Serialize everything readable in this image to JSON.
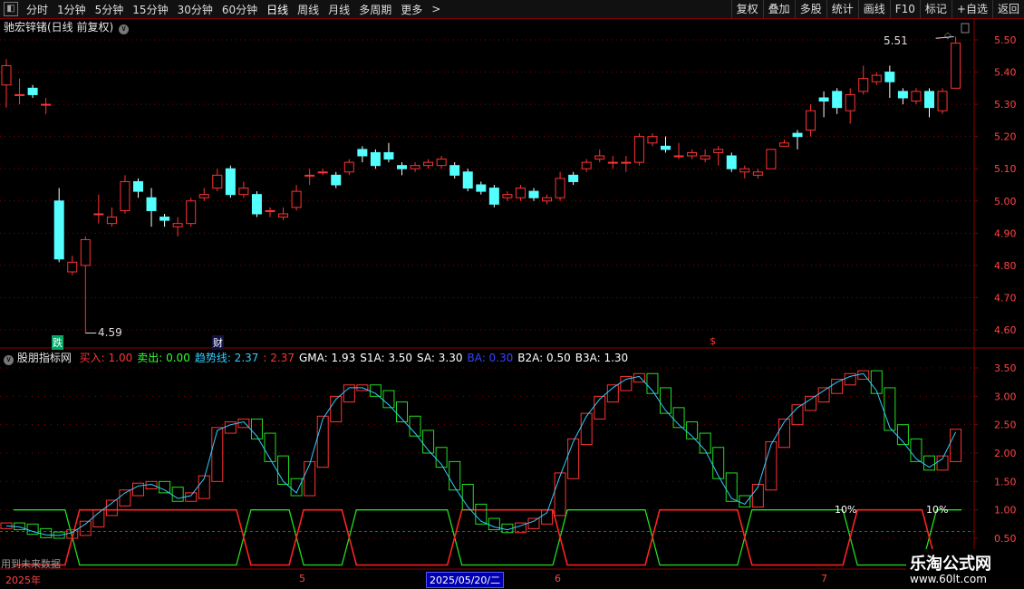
{
  "toolbar": {
    "periods": [
      "分时",
      "1分钟",
      "5分钟",
      "15分钟",
      "30分钟",
      "60分钟",
      "日线",
      "周线",
      "月线",
      "多周期",
      "更多"
    ],
    "active_period": "日线",
    "more_arrow": ">",
    "actions": [
      "复权",
      "叠加",
      "多股",
      "统计",
      "画线",
      "F10",
      "标记",
      "+自选",
      "返回"
    ]
  },
  "main_panel": {
    "title": "驰宏锌锗(日线 前复权)",
    "high_label": "5.51",
    "low_label": "4.59",
    "markers": [
      "跌",
      "财",
      "$"
    ]
  },
  "indicator_panel": {
    "name": "股朋指标网",
    "params": [
      {
        "label": "买入:",
        "value": "1.00",
        "color": "#ff3333"
      },
      {
        "label": "卖出:",
        "value": "0.00",
        "color": "#33ff33"
      },
      {
        "label": "趋势线:",
        "value": "2.37",
        "color": "#33ccff"
      },
      {
        "label": ":",
        "value": "2.37",
        "color": "#ff3333"
      },
      {
        "label": "GMA:",
        "value": "1.93",
        "color": "#ffffff"
      },
      {
        "label": "S1A:",
        "value": "3.50",
        "color": "#ffffff"
      },
      {
        "label": "SA:",
        "value": "3.30",
        "color": "#ffffff"
      },
      {
        "label": "BA:",
        "value": "0.30",
        "color": "#3344ff"
      },
      {
        "label": "B2A:",
        "value": "0.50",
        "color": "#ffffff"
      },
      {
        "label": "B3A:",
        "value": "1.30",
        "color": "#ffffff"
      }
    ],
    "pct_labels": [
      "10%",
      "10%"
    ],
    "future_note": "用到未来数据"
  },
  "date_axis": {
    "labels": [
      "2025年",
      "5",
      "6",
      "7"
    ],
    "cursor_date": "2025/05/20/二"
  },
  "watermark": {
    "line1": "乐淘公式网",
    "line2": "www.60lt.com"
  },
  "colors": {
    "up": "#ff3333",
    "down": "#54ffff",
    "grid": "#8b0000",
    "buy": "#ff2222",
    "sell": "#22dd22",
    "trend": "#33ccff"
  },
  "chart_data": {
    "type": "candlestick",
    "price_axis": {
      "ticks": [
        5.5,
        5.4,
        5.3,
        5.2,
        5.1,
        5.0,
        4.9,
        4.8,
        4.7,
        4.6
      ],
      "ylim": [
        4.55,
        5.56
      ]
    },
    "indicator_axis": {
      "ticks": [
        3.5,
        3.0,
        2.5,
        2.0,
        1.5,
        1.0,
        0.5
      ],
      "ylim": [
        0.45,
        3.62
      ]
    },
    "candles": [
      [
        5.36,
        5.42,
        5.44,
        5.29
      ],
      [
        5.33,
        5.33,
        5.38,
        5.3
      ],
      [
        5.35,
        5.33,
        5.36,
        5.32
      ],
      [
        5.3,
        5.3,
        5.32,
        5.27
      ],
      [
        5.0,
        4.82,
        5.04,
        4.81
      ],
      [
        4.78,
        4.81,
        4.83,
        4.77
      ],
      [
        4.8,
        4.88,
        4.89,
        4.59
      ],
      [
        4.96,
        4.96,
        5.02,
        4.93
      ],
      [
        4.93,
        4.95,
        4.98,
        4.92
      ],
      [
        4.97,
        5.06,
        5.08,
        4.96
      ],
      [
        5.06,
        5.03,
        5.07,
        5.01
      ],
      [
        5.01,
        4.97,
        5.04,
        4.92
      ],
      [
        4.95,
        4.94,
        4.96,
        4.92
      ],
      [
        4.92,
        4.93,
        4.95,
        4.89
      ],
      [
        4.93,
        5.0,
        5.01,
        4.92
      ],
      [
        5.01,
        5.02,
        5.04,
        5.0
      ],
      [
        5.04,
        5.08,
        5.1,
        5.03
      ],
      [
        5.1,
        5.02,
        5.11,
        5.01
      ],
      [
        5.02,
        5.04,
        5.06,
        5.01
      ],
      [
        5.02,
        4.96,
        5.03,
        4.95
      ],
      [
        4.97,
        4.97,
        4.98,
        4.95
      ],
      [
        4.95,
        4.96,
        4.98,
        4.94
      ],
      [
        4.98,
        5.03,
        5.05,
        4.97
      ],
      [
        5.08,
        5.08,
        5.1,
        5.05
      ],
      [
        5.09,
        5.09,
        5.1,
        5.08
      ],
      [
        5.08,
        5.05,
        5.09,
        5.04
      ],
      [
        5.09,
        5.12,
        5.13,
        5.08
      ],
      [
        5.16,
        5.14,
        5.17,
        5.12
      ],
      [
        5.15,
        5.11,
        5.16,
        5.1
      ],
      [
        5.15,
        5.13,
        5.18,
        5.12
      ],
      [
        5.11,
        5.1,
        5.12,
        5.08
      ],
      [
        5.1,
        5.11,
        5.12,
        5.09
      ],
      [
        5.11,
        5.12,
        5.13,
        5.1
      ],
      [
        5.11,
        5.13,
        5.14,
        5.1
      ],
      [
        5.11,
        5.08,
        5.12,
        5.07
      ],
      [
        5.09,
        5.04,
        5.1,
        5.03
      ],
      [
        5.05,
        5.03,
        5.06,
        5.02
      ],
      [
        5.04,
        4.99,
        5.05,
        4.98
      ],
      [
        5.01,
        5.02,
        5.03,
        5.0
      ],
      [
        5.01,
        5.04,
        5.05,
        5.0
      ],
      [
        5.03,
        5.01,
        5.04,
        5.0
      ],
      [
        5.0,
        5.01,
        5.02,
        4.99
      ],
      [
        5.01,
        5.07,
        5.09,
        5.0
      ],
      [
        5.08,
        5.06,
        5.09,
        5.05
      ],
      [
        5.1,
        5.12,
        5.13,
        5.09
      ],
      [
        5.13,
        5.14,
        5.16,
        5.12
      ],
      [
        5.12,
        5.12,
        5.14,
        5.1
      ],
      [
        5.12,
        5.12,
        5.14,
        5.09
      ],
      [
        5.12,
        5.2,
        5.21,
        5.11
      ],
      [
        5.18,
        5.2,
        5.21,
        5.17
      ],
      [
        5.17,
        5.16,
        5.2,
        5.15
      ],
      [
        5.14,
        5.14,
        5.18,
        5.13
      ],
      [
        5.14,
        5.15,
        5.16,
        5.13
      ],
      [
        5.13,
        5.14,
        5.16,
        5.12
      ],
      [
        5.15,
        5.16,
        5.17,
        5.11
      ],
      [
        5.14,
        5.1,
        5.15,
        5.09
      ],
      [
        5.09,
        5.1,
        5.11,
        5.07
      ],
      [
        5.08,
        5.09,
        5.1,
        5.07
      ],
      [
        5.1,
        5.16,
        5.16,
        5.1
      ],
      [
        5.17,
        5.18,
        5.19,
        5.17
      ],
      [
        5.21,
        5.2,
        5.22,
        5.16
      ],
      [
        5.22,
        5.28,
        5.3,
        5.2
      ],
      [
        5.32,
        5.31,
        5.34,
        5.26
      ],
      [
        5.34,
        5.29,
        5.35,
        5.27
      ],
      [
        5.28,
        5.33,
        5.35,
        5.24
      ],
      [
        5.34,
        5.38,
        5.42,
        5.33
      ],
      [
        5.37,
        5.39,
        5.4,
        5.36
      ],
      [
        5.4,
        5.37,
        5.42,
        5.32
      ],
      [
        5.34,
        5.32,
        5.35,
        5.3
      ],
      [
        5.31,
        5.34,
        5.35,
        5.3
      ],
      [
        5.34,
        5.29,
        5.35,
        5.26
      ],
      [
        5.28,
        5.34,
        5.35,
        5.27
      ],
      [
        5.35,
        5.49,
        5.51,
        5.35
      ]
    ]
  }
}
